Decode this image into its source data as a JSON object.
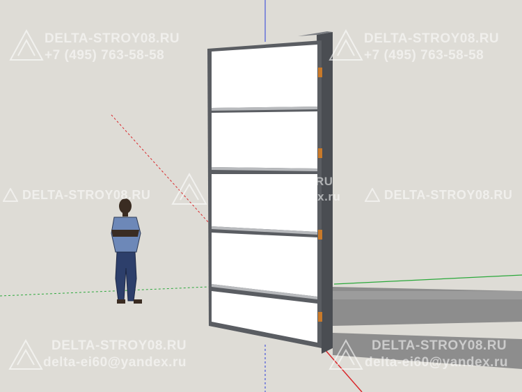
{
  "watermark": {
    "site": "DELTA-STROY08.RU",
    "site_lower": "DELTA-STROY08.RU",
    "phone": "+7 (495) 763-58-58",
    "email": "delta-ei60@yandex.ru",
    "email_alt": "delta-ei60@yandex.ru"
  },
  "colors": {
    "background": "#dedcd6",
    "frame": "#5a5d62",
    "panel": "#ffffff",
    "hinge": "#c97a2a",
    "shadow": "#8d8d8d",
    "axis_blue": "#2a3cd9",
    "axis_red": "#d9262a",
    "axis_green": "#2aa83a"
  }
}
